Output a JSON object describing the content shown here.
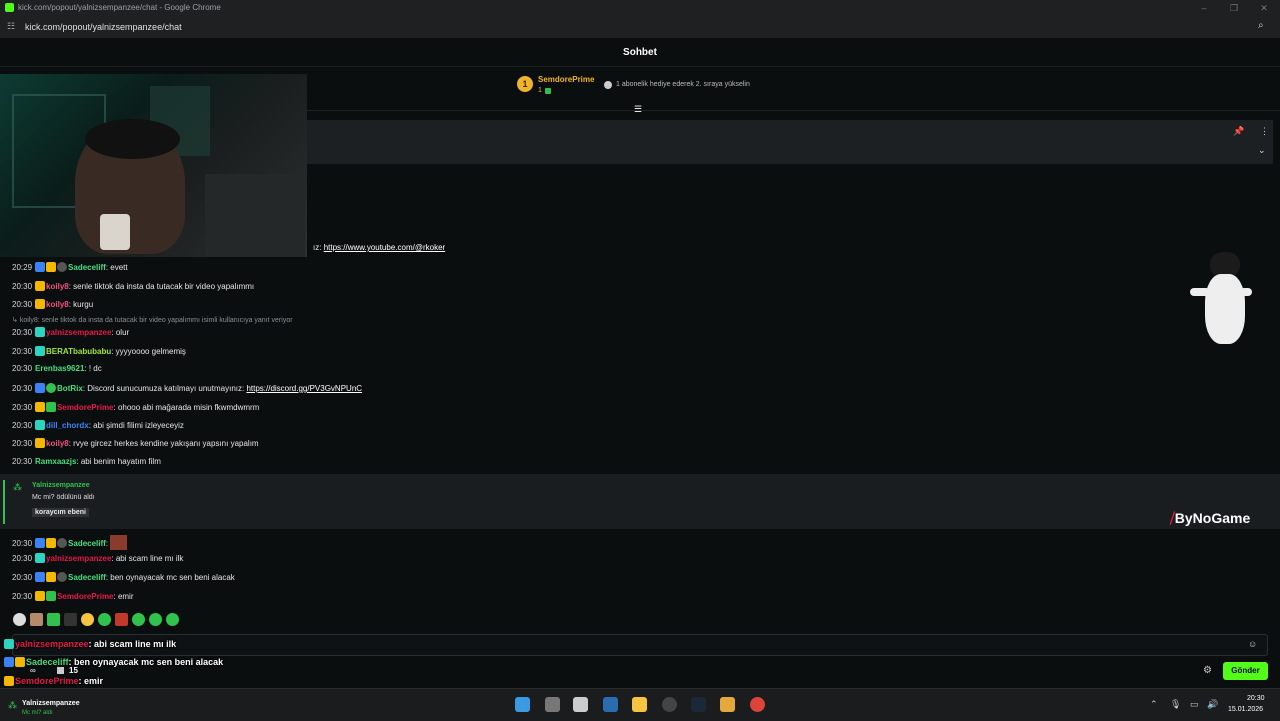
{
  "window": {
    "title": "kick.com/popout/yalnizsempanzee/chat - Google Chrome",
    "url": "kick.com/popout/yalnizsempanzee/chat"
  },
  "header": {
    "title": "Sohbet"
  },
  "gifter": {
    "rank": "1",
    "name": "SemdorePrime",
    "count": "1",
    "hint": "1 abonelik hediye ederek 2. sıraya yükselin"
  },
  "pinned": {
    "youtube_prefix": "ız:",
    "youtube_link": "https://www.youtube.com/@rkoker"
  },
  "messages": [
    {
      "time": "20:29",
      "user": "Sadeceliff",
      "color": "#4ade80",
      "text": ": evett"
    },
    {
      "time": "20:30",
      "user": "koily8",
      "color": "#f0527a",
      "text": ": senle tiktok da insta da tutacak bir video yapalımmı"
    },
    {
      "time": "20:30",
      "user": "koily8",
      "color": "#f0527a",
      "text": ": kurgu"
    },
    {
      "reply": "koily8: senle tiktok da insta da tutacak bir video yapalımmı isimli kullanıcıya yanıt veriyor"
    },
    {
      "time": "20:30",
      "user": "yalnizsempanzee",
      "color": "#e5194a",
      "text": ": olur"
    },
    {
      "time": "20:30",
      "user": "BERATbabubabu",
      "color": "#a3e635",
      "text": ": yyyyoooo gelmemiş"
    },
    {
      "time": "20:30",
      "user": "Erenbas9621",
      "color": "#4ade80",
      "text": ": ! dc"
    },
    {
      "time": "20:30",
      "user": "BotRix",
      "color": "#4ade80",
      "text": ": Discord sunucumuza katılmayı unutmayınız: ",
      "link": "https://discord.gg/PV3GvNPUnC"
    },
    {
      "time": "20:30",
      "user": "SemdorePrime",
      "color": "#e5194a",
      "text": ": ohooo abi mağarada misin fkwmdwmrm"
    },
    {
      "time": "20:30",
      "user": "dill_chordx",
      "color": "#3b82f6",
      "text": ": abi şimdi filimi izleyeceyiz"
    },
    {
      "time": "20:30",
      "user": "koily8",
      "color": "#f0527a",
      "text": ": rvye gircez herkes kendine yakışanı yapsını yapalım"
    },
    {
      "time": "20:30",
      "user": "Ramxaazjs",
      "color": "#4ade80",
      "text": ": abi benim hayatım film"
    }
  ],
  "reward": {
    "user": "Yalnizsempanzee",
    "line": "Mc mi? ödülünü aldı",
    "tag": "koraycım ebeni"
  },
  "messages2": [
    {
      "time": "20:30",
      "user": "Sadeceliff",
      "color": "#4ade80",
      "text": ":"
    },
    {
      "time": "20:30",
      "user": "yalnizsempanzee",
      "color": "#e5194a",
      "text": ": abi scam line mı ilk"
    },
    {
      "time": "20:30",
      "user": "Sadeceliff",
      "color": "#4ade80",
      "text": ": ben oynayacak mc sen beni alacak"
    },
    {
      "time": "20:30",
      "user": "SemdorePrime",
      "color": "#e5194a",
      "text": ": emir"
    }
  ],
  "overlay": {
    "line1_user": "yalnizsempanzee",
    "line1_text": ": abi scam line mı ilk",
    "line2_user": "Sadeceliff",
    "line2_text": ": ben oynayacak mc sen beni alacak",
    "line3_user": "SemdorePrime",
    "line3_text": ": emir",
    "infinity": "∞",
    "count": "15"
  },
  "brand": {
    "logo": "ByNoGame"
  },
  "chat": {
    "send": "Gönder"
  },
  "taskbar": {
    "time": "20:30",
    "date": "15.01.2026",
    "notif_user": "Yalnizsempanzee",
    "notif_text": "Mc mi? aldı"
  }
}
